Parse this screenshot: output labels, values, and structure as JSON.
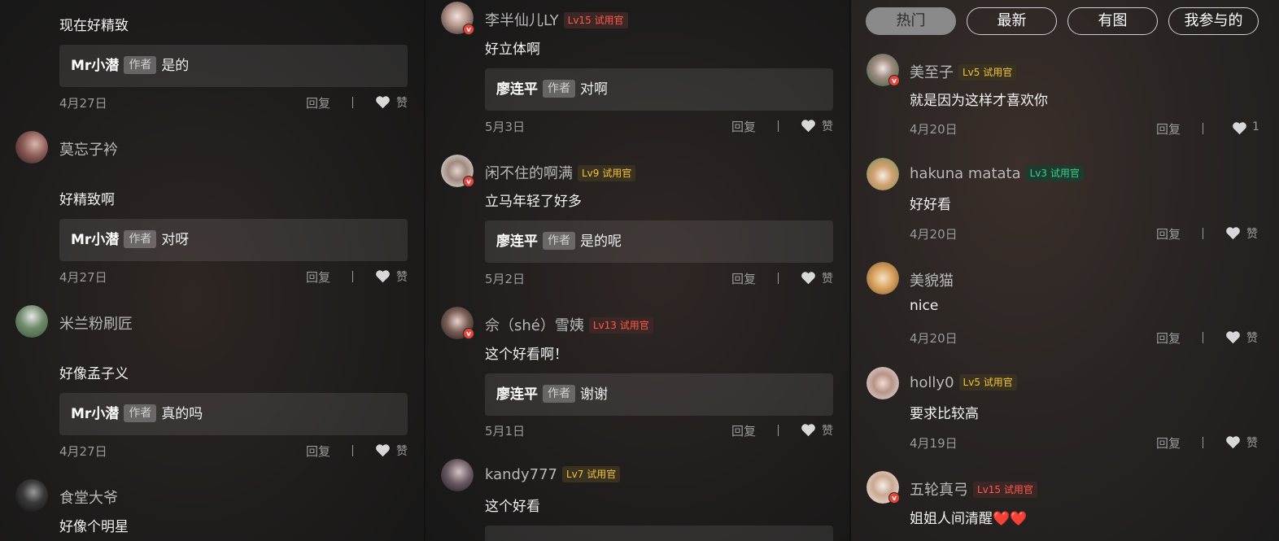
{
  "labels": {
    "reply": "回复",
    "like": "赞",
    "author_tag": "作者"
  },
  "filters": [
    "热门",
    "最新",
    "有图",
    "我参与的"
  ],
  "col1": {
    "items": [
      {
        "text": "现在好精致",
        "reply_name": "Mr小潜",
        "reply_text": "是的",
        "date": "4月27日",
        "likes": "赞"
      },
      {
        "user": "莫忘子衿",
        "text": "好精致啊",
        "reply_name": "Mr小潜",
        "reply_text": "对呀",
        "date": "4月27日",
        "likes": "赞"
      },
      {
        "user": "米兰粉刷匠",
        "text": "好像孟子义",
        "reply_name": "Mr小潜",
        "reply_text": "真的吗",
        "date": "4月27日",
        "likes": "赞"
      },
      {
        "user": "食堂大爷",
        "text": "好像个明星"
      }
    ]
  },
  "col2": {
    "items": [
      {
        "user": "李半仙儿LY",
        "level": "Lv15 试用官",
        "text": "好立体啊",
        "reply_name": "廖连平",
        "reply_text": "对啊",
        "date": "5月3日",
        "likes": "赞"
      },
      {
        "user": "闲不住的啊满",
        "level": "Lv9 试用官",
        "text": "立马年轻了好多",
        "reply_name": "廖连平",
        "reply_text": "是的呢",
        "date": "5月2日",
        "likes": "赞"
      },
      {
        "user": "佘（shé）雪姨",
        "level": "Lv13 试用官",
        "text": "这个好看啊！",
        "reply_name": "廖连平",
        "reply_text": "谢谢",
        "date": "5月1日",
        "likes": "赞"
      },
      {
        "user": "kandy777",
        "level": "Lv7 试用官",
        "text": "这个好看"
      }
    ]
  },
  "col3": {
    "items": [
      {
        "user": "美至子",
        "level": "Lv5 试用官",
        "text": "就是因为这样才喜欢你",
        "date": "4月20日",
        "likes": "1"
      },
      {
        "user": "hakuna matata",
        "level": "Lv3 试用官",
        "text": "好好看",
        "date": "4月20日",
        "likes": "赞"
      },
      {
        "user": "美貌猫",
        "text": "nice",
        "date": "4月20日",
        "likes": "赞"
      },
      {
        "user": "holly0",
        "level": "Lv5 试用官",
        "text": "要求比较高",
        "date": "4月19日",
        "likes": "赞"
      },
      {
        "user": "五轮真弓",
        "level": "Lv15 试用官",
        "text": "姐姐人间清醒❤️❤️"
      }
    ]
  },
  "colors": {
    "level_red": "#ff5a4a",
    "level_gold": "#f3c23a",
    "level_green": "#3ad08b",
    "vip_badge": "#e8453c"
  }
}
